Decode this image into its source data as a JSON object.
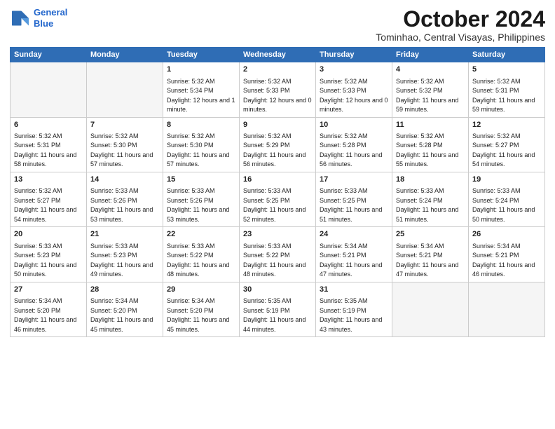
{
  "header": {
    "logo_line1": "General",
    "logo_line2": "Blue",
    "month": "October 2024",
    "location": "Tominhao, Central Visayas, Philippines"
  },
  "weekdays": [
    "Sunday",
    "Monday",
    "Tuesday",
    "Wednesday",
    "Thursday",
    "Friday",
    "Saturday"
  ],
  "weeks": [
    [
      {
        "day": "",
        "empty": true
      },
      {
        "day": "",
        "empty": true
      },
      {
        "day": "1",
        "rise": "5:32 AM",
        "set": "5:34 PM",
        "daylight": "12 hours and 1 minute."
      },
      {
        "day": "2",
        "rise": "5:32 AM",
        "set": "5:33 PM",
        "daylight": "12 hours and 0 minutes."
      },
      {
        "day": "3",
        "rise": "5:32 AM",
        "set": "5:33 PM",
        "daylight": "12 hours and 0 minutes."
      },
      {
        "day": "4",
        "rise": "5:32 AM",
        "set": "5:32 PM",
        "daylight": "11 hours and 59 minutes."
      },
      {
        "day": "5",
        "rise": "5:32 AM",
        "set": "5:31 PM",
        "daylight": "11 hours and 59 minutes."
      }
    ],
    [
      {
        "day": "6",
        "rise": "5:32 AM",
        "set": "5:31 PM",
        "daylight": "11 hours and 58 minutes."
      },
      {
        "day": "7",
        "rise": "5:32 AM",
        "set": "5:30 PM",
        "daylight": "11 hours and 57 minutes."
      },
      {
        "day": "8",
        "rise": "5:32 AM",
        "set": "5:30 PM",
        "daylight": "11 hours and 57 minutes."
      },
      {
        "day": "9",
        "rise": "5:32 AM",
        "set": "5:29 PM",
        "daylight": "11 hours and 56 minutes."
      },
      {
        "day": "10",
        "rise": "5:32 AM",
        "set": "5:28 PM",
        "daylight": "11 hours and 56 minutes."
      },
      {
        "day": "11",
        "rise": "5:32 AM",
        "set": "5:28 PM",
        "daylight": "11 hours and 55 minutes."
      },
      {
        "day": "12",
        "rise": "5:32 AM",
        "set": "5:27 PM",
        "daylight": "11 hours and 54 minutes."
      }
    ],
    [
      {
        "day": "13",
        "rise": "5:32 AM",
        "set": "5:27 PM",
        "daylight": "11 hours and 54 minutes."
      },
      {
        "day": "14",
        "rise": "5:33 AM",
        "set": "5:26 PM",
        "daylight": "11 hours and 53 minutes."
      },
      {
        "day": "15",
        "rise": "5:33 AM",
        "set": "5:26 PM",
        "daylight": "11 hours and 53 minutes."
      },
      {
        "day": "16",
        "rise": "5:33 AM",
        "set": "5:25 PM",
        "daylight": "11 hours and 52 minutes."
      },
      {
        "day": "17",
        "rise": "5:33 AM",
        "set": "5:25 PM",
        "daylight": "11 hours and 51 minutes."
      },
      {
        "day": "18",
        "rise": "5:33 AM",
        "set": "5:24 PM",
        "daylight": "11 hours and 51 minutes."
      },
      {
        "day": "19",
        "rise": "5:33 AM",
        "set": "5:24 PM",
        "daylight": "11 hours and 50 minutes."
      }
    ],
    [
      {
        "day": "20",
        "rise": "5:33 AM",
        "set": "5:23 PM",
        "daylight": "11 hours and 50 minutes."
      },
      {
        "day": "21",
        "rise": "5:33 AM",
        "set": "5:23 PM",
        "daylight": "11 hours and 49 minutes."
      },
      {
        "day": "22",
        "rise": "5:33 AM",
        "set": "5:22 PM",
        "daylight": "11 hours and 48 minutes."
      },
      {
        "day": "23",
        "rise": "5:33 AM",
        "set": "5:22 PM",
        "daylight": "11 hours and 48 minutes."
      },
      {
        "day": "24",
        "rise": "5:34 AM",
        "set": "5:21 PM",
        "daylight": "11 hours and 47 minutes."
      },
      {
        "day": "25",
        "rise": "5:34 AM",
        "set": "5:21 PM",
        "daylight": "11 hours and 47 minutes."
      },
      {
        "day": "26",
        "rise": "5:34 AM",
        "set": "5:21 PM",
        "daylight": "11 hours and 46 minutes."
      }
    ],
    [
      {
        "day": "27",
        "rise": "5:34 AM",
        "set": "5:20 PM",
        "daylight": "11 hours and 46 minutes."
      },
      {
        "day": "28",
        "rise": "5:34 AM",
        "set": "5:20 PM",
        "daylight": "11 hours and 45 minutes."
      },
      {
        "day": "29",
        "rise": "5:34 AM",
        "set": "5:20 PM",
        "daylight": "11 hours and 45 minutes."
      },
      {
        "day": "30",
        "rise": "5:35 AM",
        "set": "5:19 PM",
        "daylight": "11 hours and 44 minutes."
      },
      {
        "day": "31",
        "rise": "5:35 AM",
        "set": "5:19 PM",
        "daylight": "11 hours and 43 minutes."
      },
      {
        "day": "",
        "empty": true
      },
      {
        "day": "",
        "empty": true
      }
    ]
  ]
}
